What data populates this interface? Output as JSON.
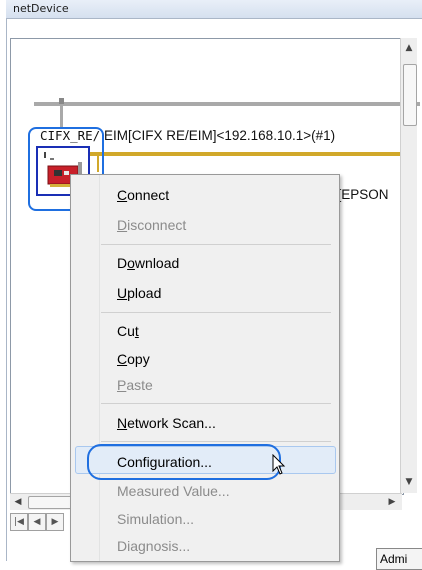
{
  "window": {
    "title": "netDevice"
  },
  "canvas": {
    "device_label": "CIFX_RE/",
    "connection_label": "EIM[CIFX RE/EIM]<192.168.10.1>(#1)",
    "slave_label_partial": "_[EPSON"
  },
  "context_menu": {
    "items": [
      {
        "label": "Connect",
        "accel": "C",
        "enabled": true
      },
      {
        "label": "Disconnect",
        "accel": "D",
        "enabled": false
      },
      {
        "label": "Download",
        "accel": "o",
        "enabled": true
      },
      {
        "label": "Upload",
        "accel": "U",
        "enabled": true
      },
      {
        "label": "Cut",
        "accel": "t",
        "enabled": true
      },
      {
        "label": "Copy",
        "accel": "C",
        "enabled": true
      },
      {
        "label": "Paste",
        "accel": "P",
        "enabled": false
      },
      {
        "label": "Network Scan...",
        "accel": "N",
        "enabled": true
      },
      {
        "label": "Configuration...",
        "accel": "",
        "enabled": true,
        "highlighted": true
      },
      {
        "label": "Measured Value...",
        "accel": "",
        "enabled": false
      },
      {
        "label": "Simulation...",
        "accel": "",
        "enabled": false
      },
      {
        "label": "Diagnosis...",
        "accel": "",
        "enabled": false
      }
    ]
  },
  "status": {
    "admin_partial": "Admi"
  },
  "colors": {
    "highlight_box": "#1f6fe0",
    "gold_bus": "#d1a82a",
    "grey_bus": "#a9a9a9",
    "disabled_text": "#8b8b8b"
  }
}
